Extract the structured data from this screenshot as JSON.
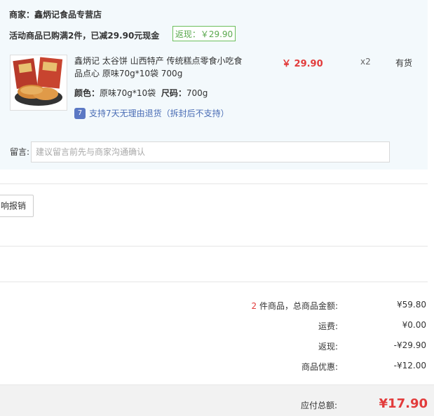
{
  "store": {
    "merchant_label": "商家：",
    "merchant_name": "鑫炳记食品专营店",
    "promo_text": "活动商品已购满2件，已减29.90元现金",
    "rebate_badge": "返现：￥29.90"
  },
  "product": {
    "title": "鑫炳记 太谷饼 山西特产 传统糕点零食小吃食品点心 原味70g*10袋 700g",
    "color_label": "颜色：",
    "color_value": "原味70g*10袋",
    "size_label": "尺码：",
    "size_value": "700g",
    "return_icon_text": "7",
    "return_policy": "支持7天无理由退货（拆封后不支持）",
    "price": "￥ 29.90",
    "quantity": "x2",
    "stock": "有货"
  },
  "note": {
    "label": "留言:",
    "placeholder": "建议留言前先与商家沟通确认"
  },
  "expense_button": "响报销",
  "summary": {
    "item_count": "2",
    "items_total_label": "件商品，总商品金额:",
    "items_total_value": "¥59.80",
    "shipping_label": "运费:",
    "shipping_value": "¥0.00",
    "rebate_label": "返现:",
    "rebate_value": "-¥29.90",
    "discount_label": "商品优惠:",
    "discount_value": "-¥12.00"
  },
  "total": {
    "label": "应付总额:",
    "value": "¥17.90"
  },
  "colors": {
    "panel_bg": "#f3f9fc",
    "price_red": "#e23b3b",
    "badge_green": "#5aa84e",
    "link_blue": "#4a6db5"
  }
}
